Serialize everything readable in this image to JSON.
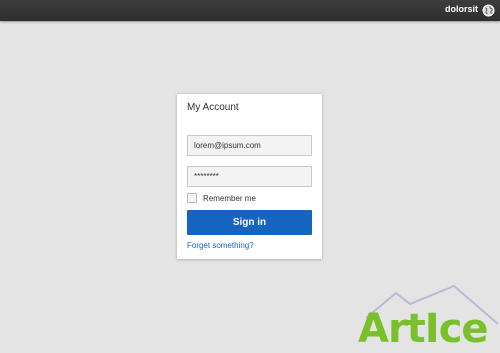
{
  "topbar": {
    "username": "dolorsit",
    "globe_icon": "globe-icon",
    "background": "#333333"
  },
  "login": {
    "title": "My Account",
    "email_value": "lorem@ipsum.com",
    "password_value": "********",
    "remember_label": "Remember me",
    "remember_checked": false,
    "signin_label": "Sign in",
    "forgot_label": "Forget something?",
    "accent_color": "#1564c0"
  },
  "watermark": {
    "text": "ArtIce"
  }
}
